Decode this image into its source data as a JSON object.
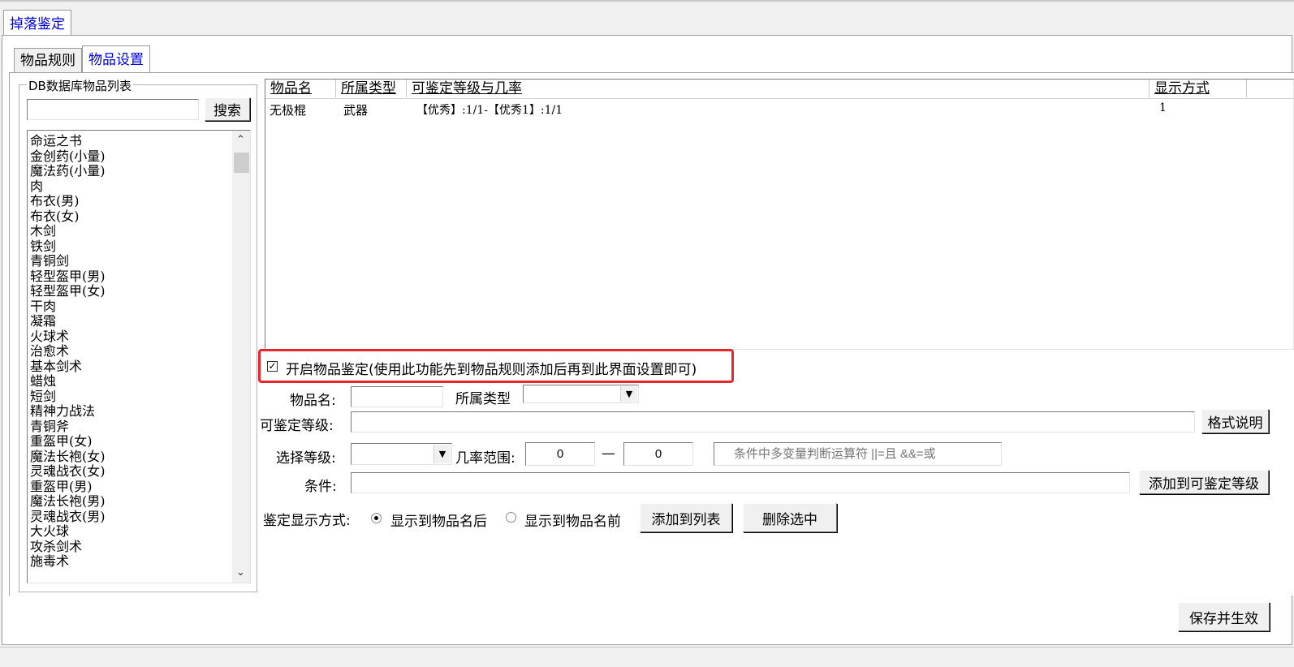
{
  "top_tab": "掉落鉴定",
  "sub_tabs": [
    "物品规则",
    "物品设置"
  ],
  "group": {
    "legend": "DB数据库物品列表",
    "search_value": "",
    "search_button": "搜索",
    "items": [
      "命运之书",
      "金创药(小量)",
      "魔法药(小量)",
      "肉",
      "布衣(男)",
      "布衣(女)",
      "木剑",
      "铁剑",
      "青铜剑",
      "轻型盔甲(男)",
      "轻型盔甲(女)",
      "干肉",
      "凝霜",
      "火球术",
      "治愈术",
      "基本剑术",
      "蜡烛",
      "短剑",
      "精神力战法",
      "青铜斧",
      "重盔甲(女)",
      "魔法长袍(女)",
      "灵魂战衣(女)",
      "重盔甲(男)",
      "魔法长袍(男)",
      "灵魂战衣(男)",
      "大火球",
      "攻杀剑术",
      "施毒术"
    ]
  },
  "table": {
    "columns": [
      "物品名",
      "所属类型",
      "可鉴定等级与几率",
      "显示方式"
    ],
    "rows": [
      {
        "name": "无极棍",
        "type": "武器",
        "levels": "【优秀】:1/1-【优秀1】:1/1",
        "display": "1"
      }
    ]
  },
  "form": {
    "enable_checkbox_label": "开启物品鉴定(使用此功能先到物品规则添加后再到此界面设置即可)",
    "enable_checked": true,
    "item_name_label": "物品名:",
    "item_name_value": "",
    "type_label": "所属类型",
    "type_value": "",
    "level_label": "可鉴定等级:",
    "level_value": "",
    "format_button": "格式说明",
    "select_level_label": "选择等级:",
    "select_level_value": "",
    "rate_label": "几率范围:",
    "rate_min": "0",
    "rate_dash": "—",
    "rate_max": "0",
    "hint_placeholder": "条件中多变量判断运算符 ||=且 &&=或",
    "condition_label": "条件:",
    "condition_value": "",
    "add_level_button": "添加到可鉴定等级",
    "display_mode_label": "鉴定显示方式:",
    "radio_after": "显示到物品名后",
    "radio_before": "显示到物品名前",
    "radio_selected": "after",
    "add_to_list_button": "添加到列表",
    "delete_selected_button": "删除选中"
  },
  "save_button": "保存并生效",
  "colors": {
    "highlight_border": "#e8262b",
    "tab_blue": "#0000e0"
  }
}
